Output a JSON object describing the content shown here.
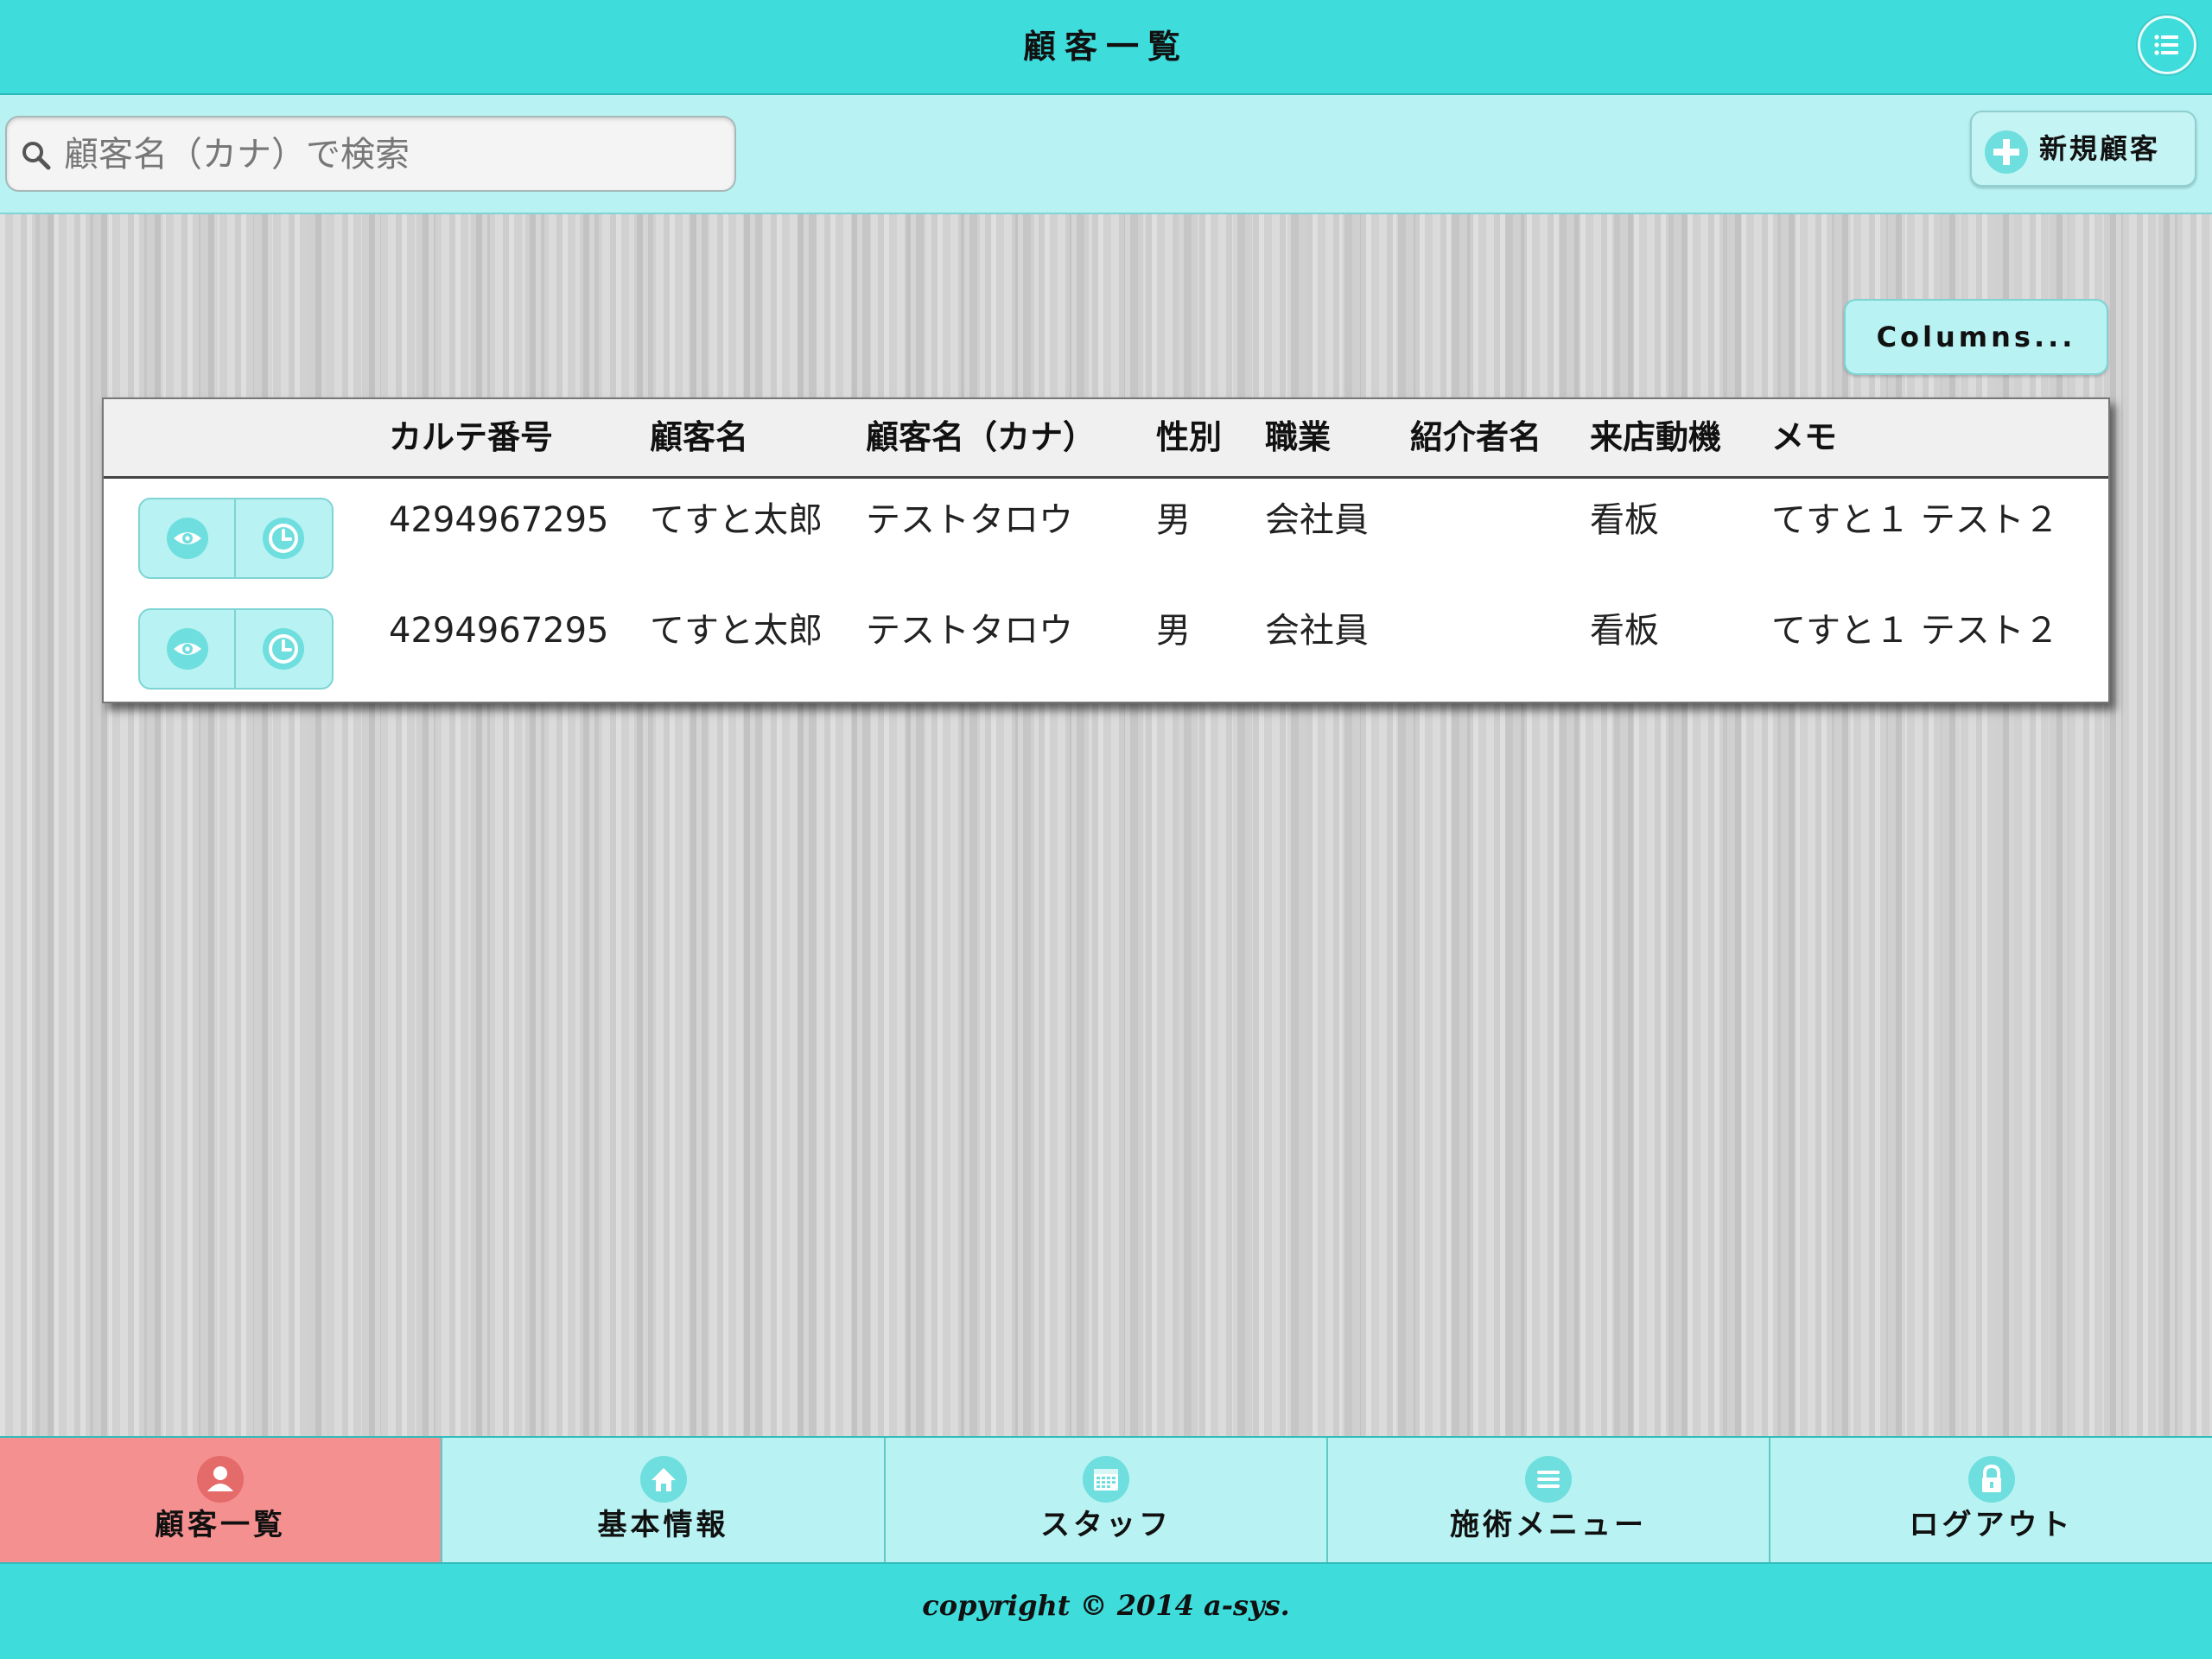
{
  "header": {
    "title": "顧客一覧",
    "menu_icon": "list-icon"
  },
  "search": {
    "placeholder": "顧客名（カナ）で検索",
    "value": ""
  },
  "actions": {
    "new_customer_label": "新規顧客",
    "columns_label": "Columns..."
  },
  "table": {
    "columns": [
      "カルテ番号",
      "顧客名",
      "顧客名（カナ）",
      "性別",
      "職業",
      "紹介者名",
      "来店動機",
      "メモ"
    ],
    "rows": [
      {
        "chart_no": "4294967295",
        "name": "てすと太郎",
        "kana": "テストタロウ",
        "gender": "男",
        "job": "会社員",
        "referrer": "",
        "motive": "看板",
        "memo": "てすと１ テスト２"
      },
      {
        "chart_no": "4294967295",
        "name": "てすと太郎",
        "kana": "テストタロウ",
        "gender": "男",
        "job": "会社員",
        "referrer": "",
        "motive": "看板",
        "memo": "てすと１ テスト２"
      }
    ]
  },
  "nav": {
    "tabs": [
      {
        "label": "顧客一覧",
        "icon": "user-icon",
        "active": true
      },
      {
        "label": "基本情報",
        "icon": "home-icon",
        "active": false
      },
      {
        "label": "スタッフ",
        "icon": "calendar-icon",
        "active": false
      },
      {
        "label": "施術メニュー",
        "icon": "list-icon",
        "active": false
      },
      {
        "label": "ログアウト",
        "icon": "lock-icon",
        "active": false
      }
    ]
  },
  "footer": {
    "copyright": "copyright © 2014 a-sys."
  },
  "colors": {
    "header": "#3fdcdc",
    "subbar": "#b8f2f2",
    "active_tab": "#f49090",
    "icon_fill": "#6fdede"
  }
}
